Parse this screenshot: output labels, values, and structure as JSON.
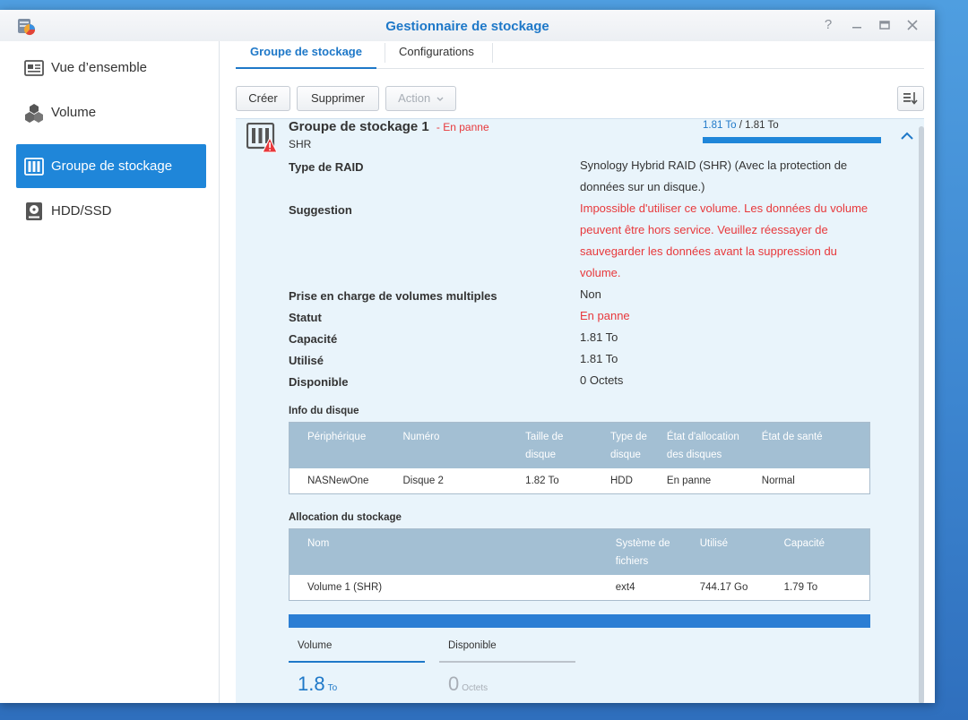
{
  "window": {
    "title": "Gestionnaire de stockage"
  },
  "sidebar": {
    "items": [
      {
        "label": "Vue d’ensemble"
      },
      {
        "label": "Volume"
      },
      {
        "label": "Groupe de stockage"
      },
      {
        "label": "HDD/SSD"
      }
    ]
  },
  "tabs": [
    {
      "label": "Groupe de stockage"
    },
    {
      "label": "Configurations"
    }
  ],
  "toolbar": {
    "create": "Créer",
    "delete": "Supprimer",
    "action": "Action"
  },
  "pool": {
    "name": "Groupe de stockage 1",
    "status_sep": "- ",
    "status": "En panne",
    "type": "SHR",
    "used": "1.81 To",
    "slash": " / ",
    "total": "1.81 To",
    "usage_fraction": 1.0
  },
  "properties": [
    {
      "label": "Type de RAID",
      "value": "Synology Hybrid RAID (SHR) (Avec la protection de données sur un disque.)",
      "color": "#333333"
    },
    {
      "label": "Suggestion",
      "value": "Impossible d'utiliser ce volume. Les données du volume peuvent être hors service. Veuillez réessayer de sauvegarder les données avant la suppression du volume.",
      "color": "#e8383b"
    },
    {
      "label": "Prise en charge de volumes multiples",
      "value": "Non",
      "color": "#333333"
    },
    {
      "label": "Statut",
      "value": "En panne",
      "color": "#e8383b"
    },
    {
      "label": "Capacité",
      "value": "1.81 To",
      "color": "#333333"
    },
    {
      "label": "Utilisé",
      "value": "1.81 To",
      "color": "#333333"
    },
    {
      "label": "Disponible",
      "value": "0 Octets",
      "color": "#333333"
    }
  ],
  "disk_info": {
    "title": "Info du disque",
    "headers": [
      "Périphérique",
      "Numéro",
      "Taille de disque",
      "Type de disque",
      "État d'allocation des disques",
      "État de santé"
    ],
    "rows": [
      {
        "device": "NASNewOne",
        "number": "Disque 2",
        "size": "1.82 To",
        "type": "HDD",
        "allocation": "En panne",
        "health": "Normal"
      }
    ]
  },
  "allocation": {
    "title": "Allocation du stockage",
    "headers": [
      "Nom",
      "Système de fichiers",
      "Utilisé",
      "Capacité"
    ],
    "rows": [
      {
        "name": "Volume 1 (SHR)",
        "fs": "ext4",
        "used": "744.17 Go",
        "capacity": "1.79 To"
      }
    ]
  },
  "summary": {
    "volume": {
      "label": "Volume",
      "value": "1.8",
      "unit": "To"
    },
    "available": {
      "label": "Disponible",
      "value": "0",
      "unit": "Octets"
    }
  },
  "colors": {
    "accent": "#1e78c8",
    "danger": "#e8383b",
    "ok": "#2e9a2e",
    "panel": "#e9f4fb"
  }
}
